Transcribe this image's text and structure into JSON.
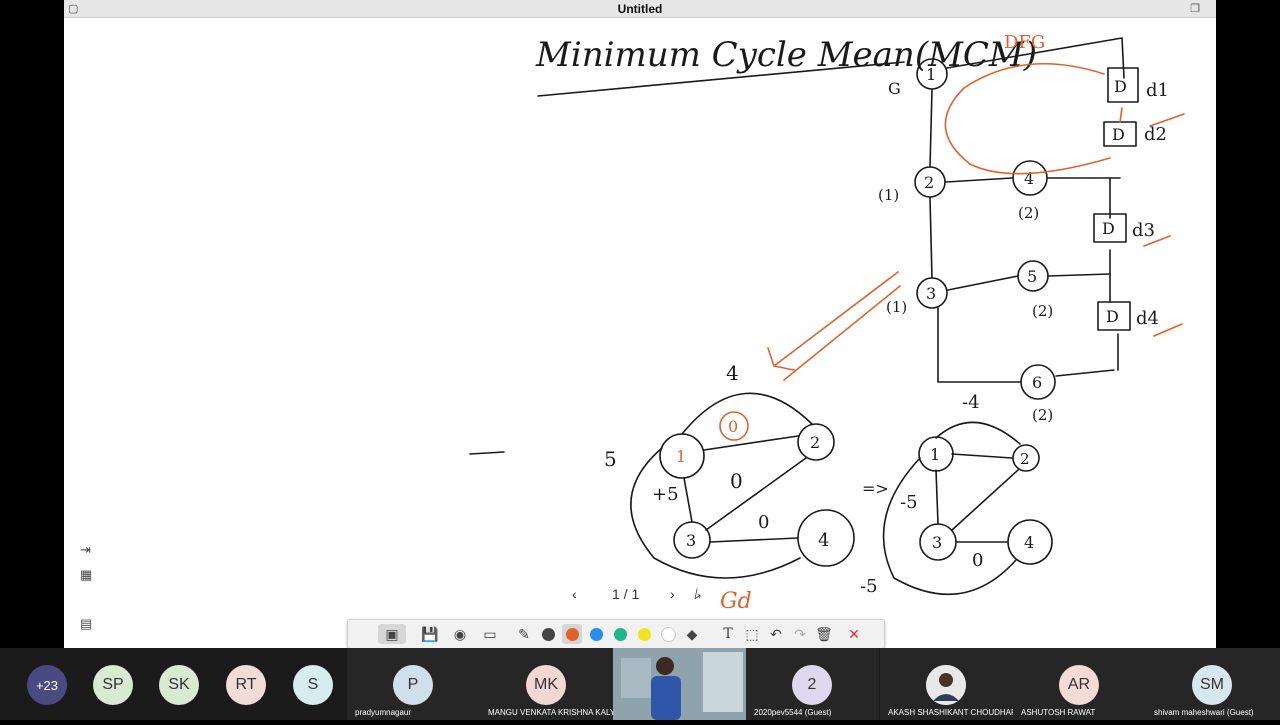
{
  "window": {
    "title": "Untitled"
  },
  "whiteboard": {
    "heading": "Minimum Cycle Mean(MCM)",
    "dfg_label": "DFG",
    "g_label": "G",
    "graph_nodes": [
      "1",
      "2",
      "3",
      "4",
      "5",
      "6"
    ],
    "node_weights": [
      "(1)",
      "(1)",
      "(2)",
      "(2)",
      "(2)"
    ],
    "delay_box": "D",
    "delays": [
      "d1",
      "d2",
      "d3",
      "d4"
    ],
    "gd_label": "Gd",
    "left_graph": {
      "top_weight": "4",
      "left_weight": "5",
      "edge_weights": [
        "0",
        "0",
        "0",
        "+5"
      ]
    },
    "right_graph": {
      "top_weight": "-4",
      "edge_weights": [
        "-5",
        "0",
        "-5"
      ]
    },
    "arrow_mark": "=>"
  },
  "pager": {
    "text": "1 / 1"
  },
  "toolbar": {
    "tools": [
      "presentation",
      "save",
      "camera",
      "toolbox",
      "pen",
      "black",
      "red",
      "blue",
      "green",
      "yellow",
      "white",
      "eraser",
      "text",
      "select",
      "undo",
      "redo",
      "delete",
      "close"
    ]
  },
  "colors": {
    "ink": "#1a1a1a",
    "annotation": "#e2622c",
    "toolbar_bg": "#f1f1f1",
    "participants_bg": "#1b1b1b"
  },
  "participants": [
    {
      "initials": "+23",
      "name": "",
      "color": "#4a4a82"
    },
    {
      "initials": "SP",
      "name": "",
      "color": "#d9ead3"
    },
    {
      "initials": "SK",
      "name": "",
      "color": "#d9ead3"
    },
    {
      "initials": "RT",
      "name": "",
      "color": "#f2dcd8"
    },
    {
      "initials": "S",
      "name": "",
      "color": "#d6ecef"
    },
    {
      "initials": "P",
      "name": "pradyumnagaur",
      "color": "#cfe0ea"
    },
    {
      "initials": "MK",
      "name": "MANGU VENKATA KRISHNA KALYAN",
      "color": "#f2d7d5"
    },
    {
      "initials": "",
      "name": "",
      "color": "#6b7f88"
    },
    {
      "initials": "2",
      "name": "2020pev5544 (Guest)",
      "color": "#ddd8ee"
    },
    {
      "initials": "",
      "name": "AKASH SHASHIKANT CHOUDHARY",
      "color": "#dadada"
    },
    {
      "initials": "AR",
      "name": "ASHUTOSH RAWAT",
      "color": "#f5dbd5"
    },
    {
      "initials": "SM",
      "name": "shivam maheshwari (Guest)",
      "color": "#d8e6f0"
    }
  ]
}
